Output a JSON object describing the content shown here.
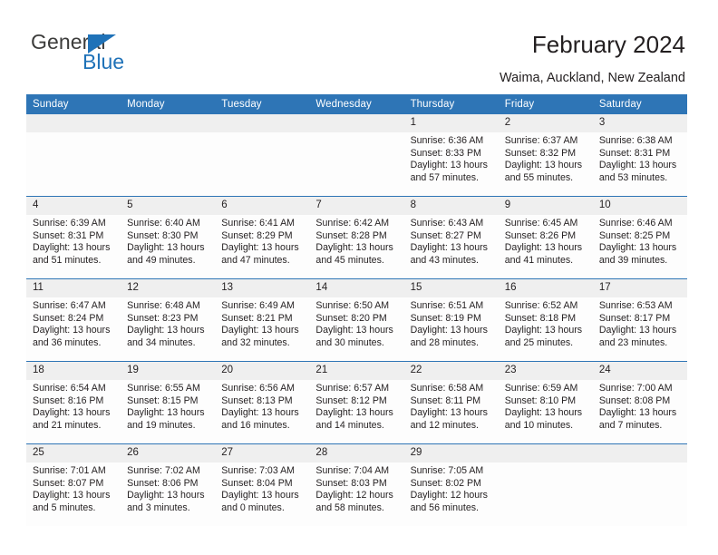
{
  "brand": {
    "name_part1": "General",
    "name_part2": "Blue",
    "triangle_icon": "blue-triangle-icon",
    "accent_color": "#1f72b8"
  },
  "header": {
    "title": "February 2024",
    "subtitle": "Waima, Auckland, New Zealand",
    "header_bg_color": "#2e75b6",
    "daynum_bg_color": "#efefef"
  },
  "weekday_headers": [
    {
      "label": "Sunday"
    },
    {
      "label": "Monday"
    },
    {
      "label": "Tuesday"
    },
    {
      "label": "Wednesday"
    },
    {
      "label": "Thursday"
    },
    {
      "label": "Friday"
    },
    {
      "label": "Saturday"
    }
  ],
  "weeks": [
    {
      "days": [
        {
          "num": "",
          "sunrise": "",
          "sunset": "",
          "daylight_1": "",
          "daylight_2": "",
          "empty": true
        },
        {
          "num": "",
          "sunrise": "",
          "sunset": "",
          "daylight_1": "",
          "daylight_2": "",
          "empty": true
        },
        {
          "num": "",
          "sunrise": "",
          "sunset": "",
          "daylight_1": "",
          "daylight_2": "",
          "empty": true
        },
        {
          "num": "",
          "sunrise": "",
          "sunset": "",
          "daylight_1": "",
          "daylight_2": "",
          "empty": true
        },
        {
          "num": "1",
          "sunrise": "Sunrise: 6:36 AM",
          "sunset": "Sunset: 8:33 PM",
          "daylight_1": "Daylight: 13 hours",
          "daylight_2": "and 57 minutes.",
          "empty": false
        },
        {
          "num": "2",
          "sunrise": "Sunrise: 6:37 AM",
          "sunset": "Sunset: 8:32 PM",
          "daylight_1": "Daylight: 13 hours",
          "daylight_2": "and 55 minutes.",
          "empty": false
        },
        {
          "num": "3",
          "sunrise": "Sunrise: 6:38 AM",
          "sunset": "Sunset: 8:31 PM",
          "daylight_1": "Daylight: 13 hours",
          "daylight_2": "and 53 minutes.",
          "empty": false
        }
      ]
    },
    {
      "days": [
        {
          "num": "4",
          "sunrise": "Sunrise: 6:39 AM",
          "sunset": "Sunset: 8:31 PM",
          "daylight_1": "Daylight: 13 hours",
          "daylight_2": "and 51 minutes.",
          "empty": false
        },
        {
          "num": "5",
          "sunrise": "Sunrise: 6:40 AM",
          "sunset": "Sunset: 8:30 PM",
          "daylight_1": "Daylight: 13 hours",
          "daylight_2": "and 49 minutes.",
          "empty": false
        },
        {
          "num": "6",
          "sunrise": "Sunrise: 6:41 AM",
          "sunset": "Sunset: 8:29 PM",
          "daylight_1": "Daylight: 13 hours",
          "daylight_2": "and 47 minutes.",
          "empty": false
        },
        {
          "num": "7",
          "sunrise": "Sunrise: 6:42 AM",
          "sunset": "Sunset: 8:28 PM",
          "daylight_1": "Daylight: 13 hours",
          "daylight_2": "and 45 minutes.",
          "empty": false
        },
        {
          "num": "8",
          "sunrise": "Sunrise: 6:43 AM",
          "sunset": "Sunset: 8:27 PM",
          "daylight_1": "Daylight: 13 hours",
          "daylight_2": "and 43 minutes.",
          "empty": false
        },
        {
          "num": "9",
          "sunrise": "Sunrise: 6:45 AM",
          "sunset": "Sunset: 8:26 PM",
          "daylight_1": "Daylight: 13 hours",
          "daylight_2": "and 41 minutes.",
          "empty": false
        },
        {
          "num": "10",
          "sunrise": "Sunrise: 6:46 AM",
          "sunset": "Sunset: 8:25 PM",
          "daylight_1": "Daylight: 13 hours",
          "daylight_2": "and 39 minutes.",
          "empty": false
        }
      ]
    },
    {
      "days": [
        {
          "num": "11",
          "sunrise": "Sunrise: 6:47 AM",
          "sunset": "Sunset: 8:24 PM",
          "daylight_1": "Daylight: 13 hours",
          "daylight_2": "and 36 minutes.",
          "empty": false
        },
        {
          "num": "12",
          "sunrise": "Sunrise: 6:48 AM",
          "sunset": "Sunset: 8:23 PM",
          "daylight_1": "Daylight: 13 hours",
          "daylight_2": "and 34 minutes.",
          "empty": false
        },
        {
          "num": "13",
          "sunrise": "Sunrise: 6:49 AM",
          "sunset": "Sunset: 8:21 PM",
          "daylight_1": "Daylight: 13 hours",
          "daylight_2": "and 32 minutes.",
          "empty": false
        },
        {
          "num": "14",
          "sunrise": "Sunrise: 6:50 AM",
          "sunset": "Sunset: 8:20 PM",
          "daylight_1": "Daylight: 13 hours",
          "daylight_2": "and 30 minutes.",
          "empty": false
        },
        {
          "num": "15",
          "sunrise": "Sunrise: 6:51 AM",
          "sunset": "Sunset: 8:19 PM",
          "daylight_1": "Daylight: 13 hours",
          "daylight_2": "and 28 minutes.",
          "empty": false
        },
        {
          "num": "16",
          "sunrise": "Sunrise: 6:52 AM",
          "sunset": "Sunset: 8:18 PM",
          "daylight_1": "Daylight: 13 hours",
          "daylight_2": "and 25 minutes.",
          "empty": false
        },
        {
          "num": "17",
          "sunrise": "Sunrise: 6:53 AM",
          "sunset": "Sunset: 8:17 PM",
          "daylight_1": "Daylight: 13 hours",
          "daylight_2": "and 23 minutes.",
          "empty": false
        }
      ]
    },
    {
      "days": [
        {
          "num": "18",
          "sunrise": "Sunrise: 6:54 AM",
          "sunset": "Sunset: 8:16 PM",
          "daylight_1": "Daylight: 13 hours",
          "daylight_2": "and 21 minutes.",
          "empty": false
        },
        {
          "num": "19",
          "sunrise": "Sunrise: 6:55 AM",
          "sunset": "Sunset: 8:15 PM",
          "daylight_1": "Daylight: 13 hours",
          "daylight_2": "and 19 minutes.",
          "empty": false
        },
        {
          "num": "20",
          "sunrise": "Sunrise: 6:56 AM",
          "sunset": "Sunset: 8:13 PM",
          "daylight_1": "Daylight: 13 hours",
          "daylight_2": "and 16 minutes.",
          "empty": false
        },
        {
          "num": "21",
          "sunrise": "Sunrise: 6:57 AM",
          "sunset": "Sunset: 8:12 PM",
          "daylight_1": "Daylight: 13 hours",
          "daylight_2": "and 14 minutes.",
          "empty": false
        },
        {
          "num": "22",
          "sunrise": "Sunrise: 6:58 AM",
          "sunset": "Sunset: 8:11 PM",
          "daylight_1": "Daylight: 13 hours",
          "daylight_2": "and 12 minutes.",
          "empty": false
        },
        {
          "num": "23",
          "sunrise": "Sunrise: 6:59 AM",
          "sunset": "Sunset: 8:10 PM",
          "daylight_1": "Daylight: 13 hours",
          "daylight_2": "and 10 minutes.",
          "empty": false
        },
        {
          "num": "24",
          "sunrise": "Sunrise: 7:00 AM",
          "sunset": "Sunset: 8:08 PM",
          "daylight_1": "Daylight: 13 hours",
          "daylight_2": "and 7 minutes.",
          "empty": false
        }
      ]
    },
    {
      "days": [
        {
          "num": "25",
          "sunrise": "Sunrise: 7:01 AM",
          "sunset": "Sunset: 8:07 PM",
          "daylight_1": "Daylight: 13 hours",
          "daylight_2": "and 5 minutes.",
          "empty": false
        },
        {
          "num": "26",
          "sunrise": "Sunrise: 7:02 AM",
          "sunset": "Sunset: 8:06 PM",
          "daylight_1": "Daylight: 13 hours",
          "daylight_2": "and 3 minutes.",
          "empty": false
        },
        {
          "num": "27",
          "sunrise": "Sunrise: 7:03 AM",
          "sunset": "Sunset: 8:04 PM",
          "daylight_1": "Daylight: 13 hours",
          "daylight_2": "and 0 minutes.",
          "empty": false
        },
        {
          "num": "28",
          "sunrise": "Sunrise: 7:04 AM",
          "sunset": "Sunset: 8:03 PM",
          "daylight_1": "Daylight: 12 hours",
          "daylight_2": "and 58 minutes.",
          "empty": false
        },
        {
          "num": "29",
          "sunrise": "Sunrise: 7:05 AM",
          "sunset": "Sunset: 8:02 PM",
          "daylight_1": "Daylight: 12 hours",
          "daylight_2": "and 56 minutes.",
          "empty": false
        },
        {
          "num": "",
          "sunrise": "",
          "sunset": "",
          "daylight_1": "",
          "daylight_2": "",
          "empty": true
        },
        {
          "num": "",
          "sunrise": "",
          "sunset": "",
          "daylight_1": "",
          "daylight_2": "",
          "empty": true
        }
      ]
    }
  ]
}
